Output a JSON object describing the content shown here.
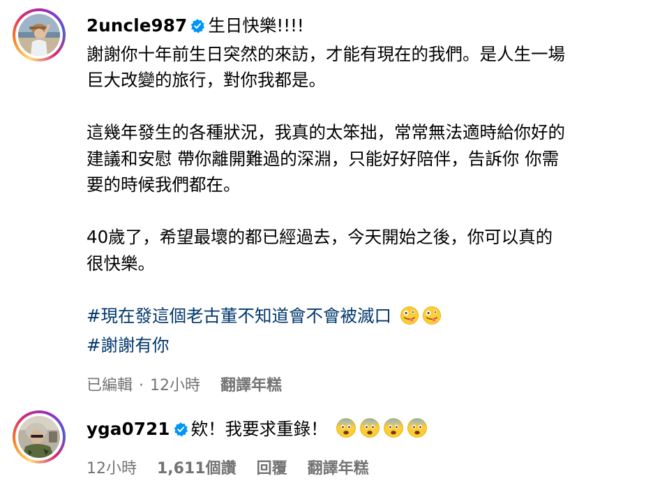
{
  "post": {
    "username": "2uncle987",
    "verified_icon": "verified-badge-icon",
    "first_line": "生日快樂!!!!",
    "lines": [
      "謝謝你十年前生日突然的來訪，才能有現在的我們。是人生一場",
      "巨大改變的旅行，對你我都是。",
      "",
      "這幾年發生的各種狀況，我真的太笨拙，常常無法適時給你好的",
      "建議和安慰 帶你離開難過的深淵，只能好好陪伴，告訴你 你需",
      "要的時候我們都在。",
      "",
      "40歲了，希望最壞的都已經過去，今天開始之後，你可以真的",
      "很快樂。"
    ],
    "hashtags": [
      "#現在發這個老古董不知道會不會被滅口",
      "#謝謝有你"
    ],
    "hashtag_emojis": [
      "zany-face-emoji",
      "zany-face-emoji"
    ],
    "meta": {
      "edited": "已編輯",
      "separator": "·",
      "time": "12小時",
      "translate": "翻譯年糕"
    },
    "colors": {
      "hashtag": "#00376b",
      "meta": "#737373",
      "verified": "#0095f6"
    }
  },
  "reply": {
    "username": "yga0721",
    "verified_icon": "verified-badge-icon",
    "text": "欸！我要求重錄！",
    "emojis": [
      "fearful-face-emoji",
      "fearful-face-emoji",
      "fearful-face-emoji",
      "fearful-face-emoji"
    ],
    "meta": {
      "time": "12小時",
      "likes": "1,611個讚",
      "reply": "回覆",
      "translate": "翻譯年糕"
    }
  }
}
